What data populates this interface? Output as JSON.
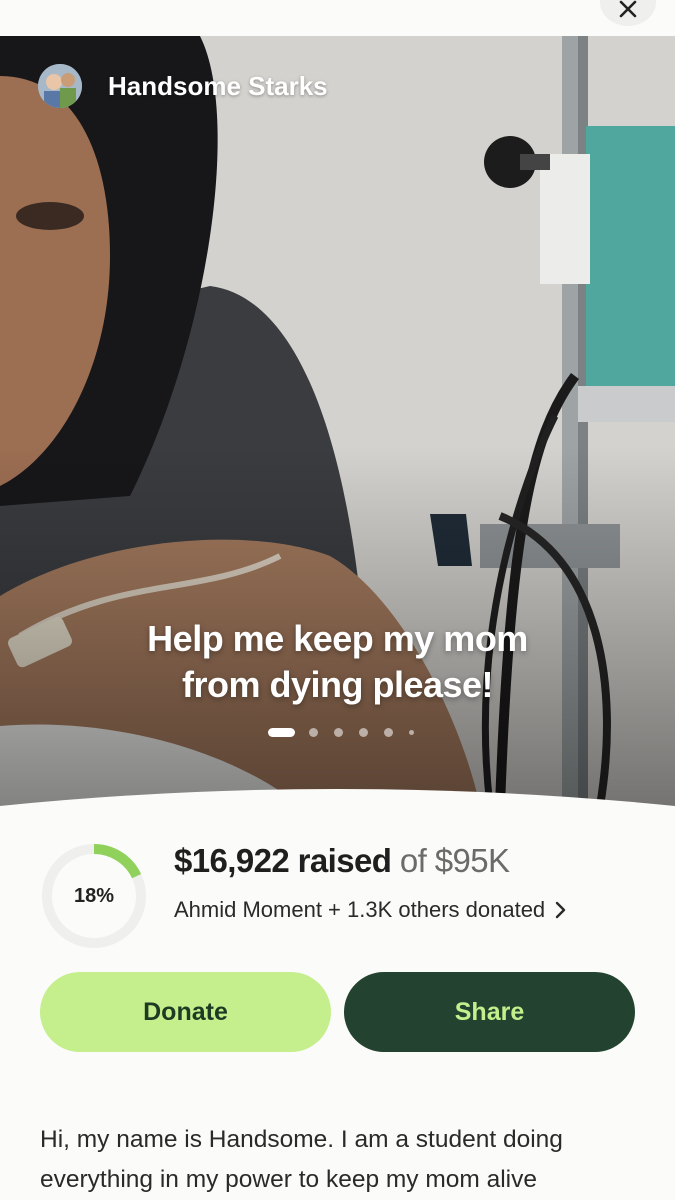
{
  "header": {
    "close_icon": "close-icon"
  },
  "organizer": {
    "name": "Handsome Starks"
  },
  "hero": {
    "title_line1": "Help me keep my mom",
    "title_line2": "from dying please!",
    "slides_total": 6,
    "active_slide": 1
  },
  "progress": {
    "percent_label": "18%",
    "fraction": 0.18,
    "raised_amount": "$16,922 raised",
    "goal_text": "of $95K",
    "donors_text": "Ahmid Moment + 1.3K others donated"
  },
  "actions": {
    "donate_label": "Donate",
    "share_label": "Share"
  },
  "story": {
    "text": "Hi, my name is Handsome. I am a student doing everything in my power to keep my mom alive"
  },
  "colors": {
    "accent_light": "#c5ef8d",
    "accent_dark": "#234330",
    "progress_fill": "#8fd15a"
  }
}
